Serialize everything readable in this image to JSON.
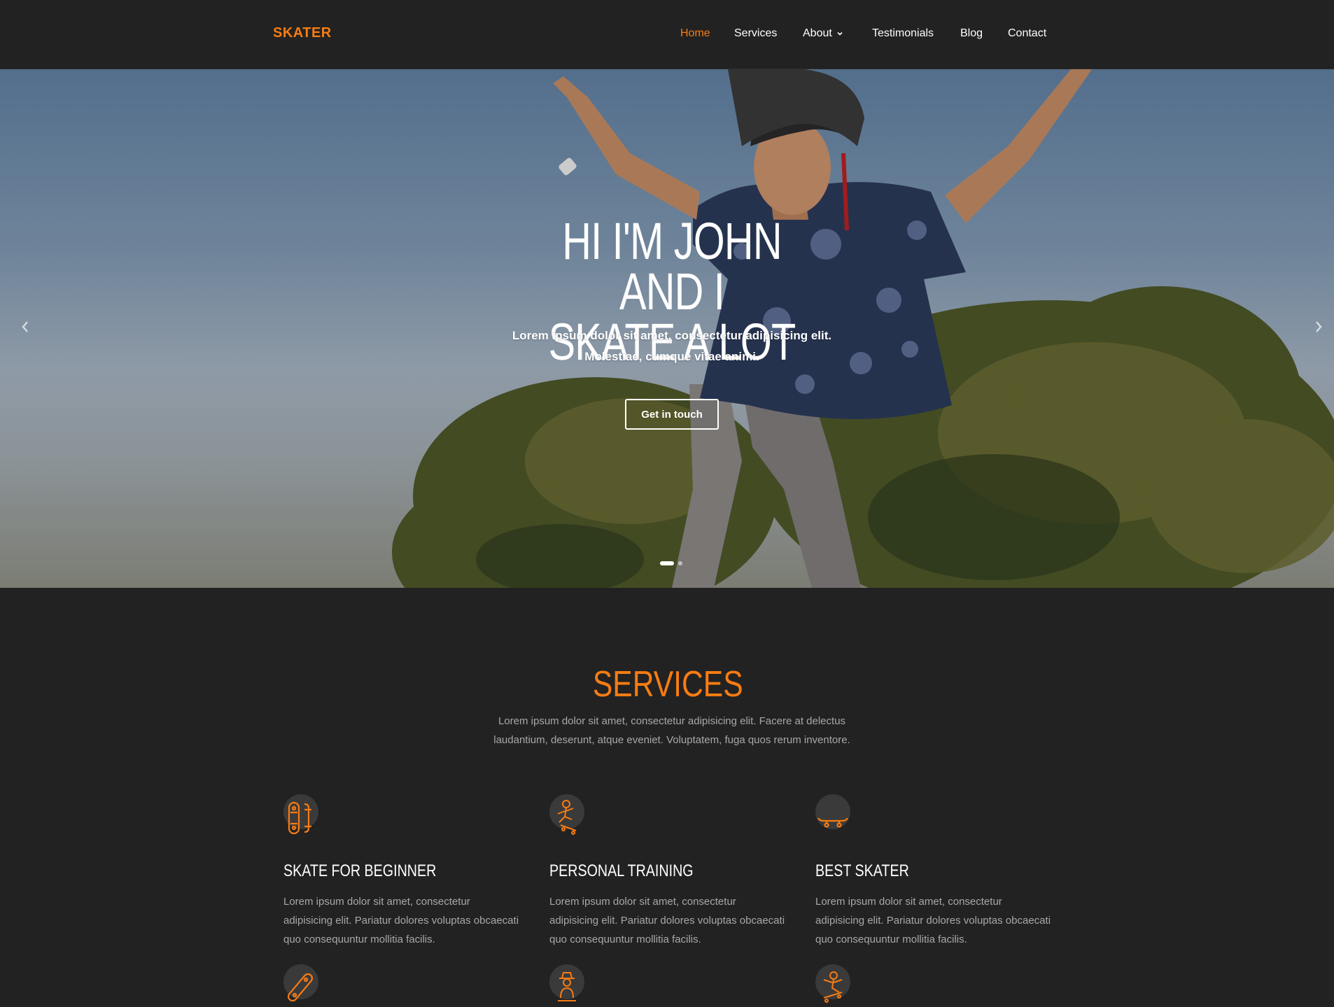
{
  "brand": "SKATER",
  "nav": {
    "home": "Home",
    "services": "Services",
    "about": "About",
    "testimonials": "Testimonials",
    "blog": "Blog",
    "contact": "Contact"
  },
  "hero": {
    "title_line1": "HI I'M JOHN AND I",
    "title_line2": "SKATE A LOT",
    "subtitle_line1": "Lorem ipsum dolor sit amet, consectetur adipisicing elit.",
    "subtitle_line2": "Molestiae, cumque vitae animi.",
    "button": "Get in touch",
    "slides_total": 2,
    "slide_active": 1
  },
  "services": {
    "title": "SERVICES",
    "desc_line1": "Lorem ipsum dolor sit amet, consectetur adipisicing elit. Facere at delectus",
    "desc_line2": "laudantium, deserunt, atque eveniet. Voluptatem, fuga quos rerum inventore.",
    "items": [
      {
        "icon": "skateboard-top-icon",
        "title": "SKATE FOR BEGINNER",
        "text": "Lorem ipsum dolor sit amet, consectetur adipisicing elit. Pariatur dolores voluptas obcaecati quo consequuntur mollitia facilis."
      },
      {
        "icon": "skater-jump-icon",
        "title": "PERSONAL TRAINING",
        "text": "Lorem ipsum dolor sit amet, consectetur adipisicing elit. Pariatur dolores voluptas obcaecati quo consequuntur mollitia facilis."
      },
      {
        "icon": "skateboard-side-icon",
        "title": "BEST SKATER",
        "text": "Lorem ipsum dolor sit amet, consectetur adipisicing elit. Pariatur dolores voluptas obcaecati quo consequuntur mollitia facilis."
      }
    ],
    "next_row_icons": [
      "skateboard-tilted-icon",
      "skater-hat-icon",
      "skater-trick-icon"
    ]
  },
  "colors": {
    "accent": "#f77c13",
    "background": "#222222",
    "muted_text": "#a8a8a8"
  }
}
